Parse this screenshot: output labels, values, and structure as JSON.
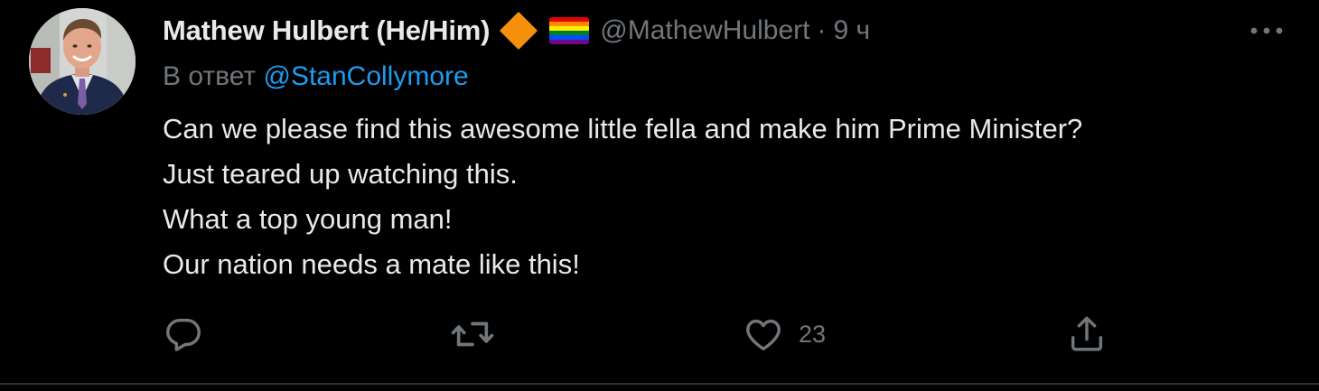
{
  "tweet": {
    "display_name": "Mathew Hulbert (He/Him)",
    "badge_icon": "orange-diamond-icon",
    "flag_icon": "rainbow-flag-icon",
    "handle": "@MathewHulbert",
    "separator": "·",
    "time": "9 ч",
    "reply_prefix": "В ответ",
    "reply_to": "@StanCollymore",
    "lines": [
      "Can we please find this awesome little fella and make him Prime Minister?",
      "Just teared up watching this.",
      "What a top young man!",
      "Our nation needs a mate like this!"
    ],
    "actions": {
      "reply_icon": "reply-bubble-icon",
      "retweet_icon": "retweet-icon",
      "like_icon": "heart-icon",
      "like_count": "23",
      "share_icon": "share-icon"
    },
    "colors": {
      "background": "#000000",
      "text": "#e7e9ea",
      "secondary": "#71767b",
      "link": "#1d9bf0",
      "badge": "#f4900c"
    }
  }
}
